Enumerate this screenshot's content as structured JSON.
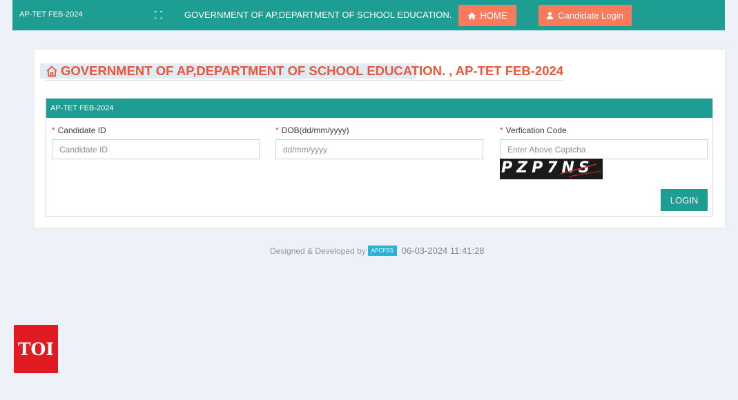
{
  "header": {
    "brand": "AP-TET FEB-2024",
    "title": "GOVERNMENT OF AP,DEPARTMENT OF SCHOOL EDUCATION.",
    "home_label": "HOME",
    "candidate_login_label": "Candidate Login",
    "bg_color": "#1e9e92",
    "button_color": "#f97a5c"
  },
  "page": {
    "title": "GOVERNMENT OF AP,DEPARTMENT OF SCHOOL EDUCATION. , AP-TET FEB-2024",
    "title_color": "#e8573a"
  },
  "form": {
    "panel_title": "AP-TET FEB-2024",
    "fields": [
      {
        "label": "Candidate ID",
        "placeholder": "Candidate ID",
        "required_mark": "*"
      },
      {
        "label": "DOB(dd/mm/yyyy)",
        "placeholder": "dd/mm/yyyy",
        "required_mark": "*"
      },
      {
        "label": "Verfication Code",
        "placeholder": "Enter Above Captcha",
        "required_mark": "*"
      }
    ],
    "captcha_text": "PZP7NS",
    "submit_label": "LOGIN"
  },
  "footer": {
    "prefix": "Designed & Developed by",
    "badge": "APCFSS",
    "timestamp": "06-03-2024 11:41:28"
  },
  "watermark": {
    "logo": "TOI"
  },
  "icons": {
    "expand": "expand-icon",
    "home": "home-icon",
    "user": "user-icon",
    "title_home": "home-outline-icon"
  }
}
